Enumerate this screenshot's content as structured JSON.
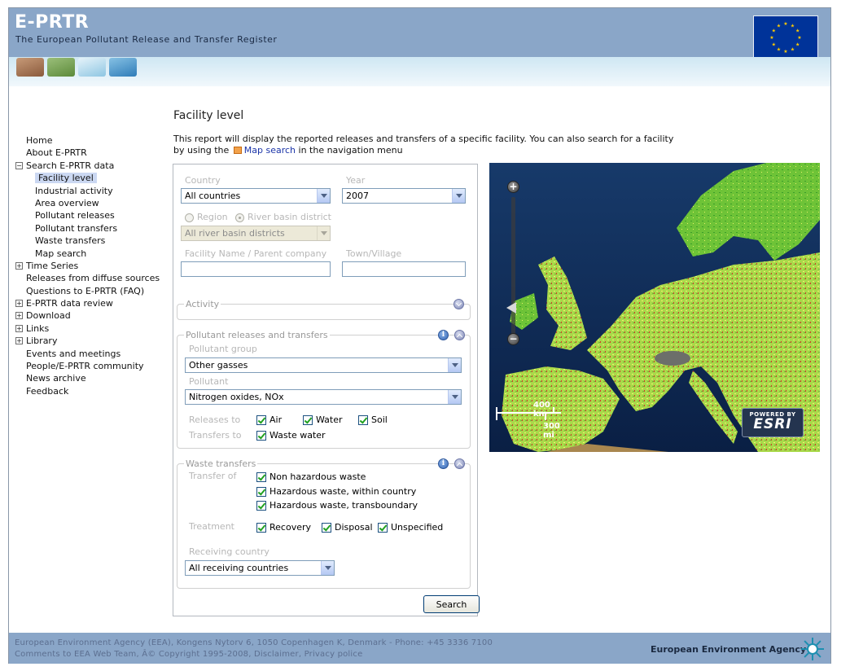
{
  "header": {
    "title": "E-PRTR",
    "subtitle": "The European Pollutant Release and Transfer Register",
    "flag": "eu-flag",
    "theme_icons": [
      "soil-icon",
      "vegetation-icon",
      "air-icon",
      "water-icon"
    ]
  },
  "nav": {
    "items": [
      {
        "label": "Home",
        "level": 1,
        "toggle": ""
      },
      {
        "label": "About E-PRTR",
        "level": 1,
        "toggle": ""
      },
      {
        "label": "Search E-PRTR data",
        "level": 1,
        "toggle": "−"
      },
      {
        "label": "Facility level",
        "level": 2,
        "toggle": "",
        "active": true
      },
      {
        "label": "Industrial activity",
        "level": 2,
        "toggle": ""
      },
      {
        "label": "Area overview",
        "level": 2,
        "toggle": ""
      },
      {
        "label": "Pollutant releases",
        "level": 2,
        "toggle": ""
      },
      {
        "label": "Pollutant transfers",
        "level": 2,
        "toggle": ""
      },
      {
        "label": "Waste transfers",
        "level": 2,
        "toggle": ""
      },
      {
        "label": "Map search",
        "level": 2,
        "toggle": ""
      },
      {
        "label": "Time Series",
        "level": 1,
        "toggle": "+"
      },
      {
        "label": "Releases from diffuse sources",
        "level": 1,
        "toggle": ""
      },
      {
        "label": "Questions to E-PRTR (FAQ)",
        "level": 1,
        "toggle": ""
      },
      {
        "label": "E-PRTR data review",
        "level": 1,
        "toggle": "+"
      },
      {
        "label": "Download",
        "level": 1,
        "toggle": "+"
      },
      {
        "label": "Links",
        "level": 1,
        "toggle": "+"
      },
      {
        "label": "Library",
        "level": 1,
        "toggle": "+"
      },
      {
        "label": "Events and meetings",
        "level": 1,
        "toggle": ""
      },
      {
        "label": "People/E-PRTR community",
        "level": 1,
        "toggle": ""
      },
      {
        "label": "News archive",
        "level": 1,
        "toggle": ""
      },
      {
        "label": "Feedback",
        "level": 1,
        "toggle": ""
      }
    ]
  },
  "main": {
    "title": "Facility level",
    "intro_before": "This report will display the reported releases and transfers of a specific facility. You can also search for a facility by using the",
    "intro_link": "Map search",
    "intro_after": "in the navigation menu"
  },
  "form": {
    "country_label": "Country",
    "country_value": "All countries",
    "year_label": "Year",
    "year_value": "2007",
    "region_label": "Region",
    "river_basin_label": "River basin district",
    "river_basin_value": "All river basin districts",
    "facility_name_label": "Facility Name / Parent company",
    "town_label": "Town/Village",
    "activity_legend": "Activity",
    "pollutant_legend": "Pollutant releases and transfers",
    "pollutant_group_label": "Pollutant group",
    "pollutant_group_value": "Other gasses",
    "pollutant_label": "Pollutant",
    "pollutant_value": "Nitrogen oxides, NOx",
    "releases_to_label": "Releases to",
    "releases_to": [
      "Air",
      "Water",
      "Soil"
    ],
    "transfers_to_label": "Transfers to",
    "transfers_to": [
      "Waste water"
    ],
    "waste_legend": "Waste transfers",
    "transfer_of_label": "Transfer of",
    "transfer_of": [
      "Non hazardous waste",
      "Hazardous waste, within country",
      "Hazardous waste, transboundary"
    ],
    "treatment_label": "Treatment",
    "treatment": [
      "Recovery",
      "Disposal",
      "Unspecified"
    ],
    "receiving_country_label": "Receiving country",
    "receiving_country_value": "All receiving countries",
    "info_icon_text": "i",
    "search_button": "Search"
  },
  "map": {
    "zoom_in": "+",
    "zoom_out": "−",
    "scale_km": "400 km",
    "scale_mi": "300 mi",
    "esri_powered": "POWERED BY",
    "esri_name": "ESRI"
  },
  "footer": {
    "line1": "European Environment Agency (EEA), Kongens Nytorv 6, 1050 Copenhagen K, Denmark - Phone: +45 3336 7100",
    "line2": "Comments to EEA Web Team, Â© Copyright 1995-2008, Disclaimer, Privacy police",
    "agency": "European Environment Agency"
  },
  "colors": {
    "header_bg": "#8aa6c8",
    "active_nav_bg": "#cbd8f2",
    "link": "#1b34a8",
    "check_green": "#21a121"
  }
}
